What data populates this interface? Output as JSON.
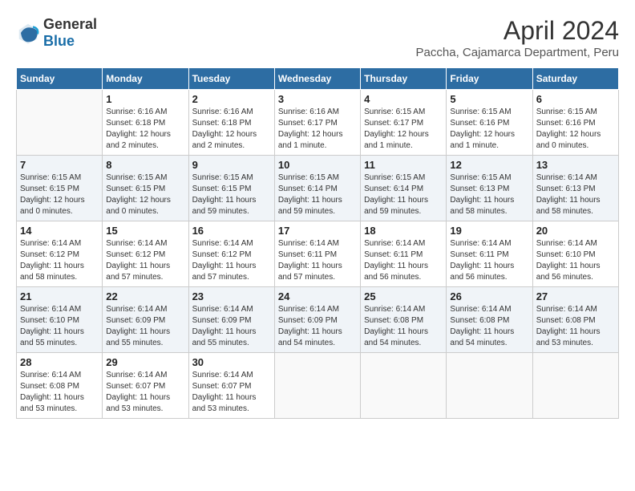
{
  "header": {
    "logo_general": "General",
    "logo_blue": "Blue",
    "title": "April 2024",
    "subtitle": "Paccha, Cajamarca Department, Peru"
  },
  "calendar": {
    "days_of_week": [
      "Sunday",
      "Monday",
      "Tuesday",
      "Wednesday",
      "Thursday",
      "Friday",
      "Saturday"
    ],
    "weeks": [
      [
        {
          "day": "",
          "info": ""
        },
        {
          "day": "1",
          "info": "Sunrise: 6:16 AM\nSunset: 6:18 PM\nDaylight: 12 hours\nand 2 minutes."
        },
        {
          "day": "2",
          "info": "Sunrise: 6:16 AM\nSunset: 6:18 PM\nDaylight: 12 hours\nand 2 minutes."
        },
        {
          "day": "3",
          "info": "Sunrise: 6:16 AM\nSunset: 6:17 PM\nDaylight: 12 hours\nand 1 minute."
        },
        {
          "day": "4",
          "info": "Sunrise: 6:15 AM\nSunset: 6:17 PM\nDaylight: 12 hours\nand 1 minute."
        },
        {
          "day": "5",
          "info": "Sunrise: 6:15 AM\nSunset: 6:16 PM\nDaylight: 12 hours\nand 1 minute."
        },
        {
          "day": "6",
          "info": "Sunrise: 6:15 AM\nSunset: 6:16 PM\nDaylight: 12 hours\nand 0 minutes."
        }
      ],
      [
        {
          "day": "7",
          "info": "Sunrise: 6:15 AM\nSunset: 6:15 PM\nDaylight: 12 hours\nand 0 minutes."
        },
        {
          "day": "8",
          "info": "Sunrise: 6:15 AM\nSunset: 6:15 PM\nDaylight: 12 hours\nand 0 minutes."
        },
        {
          "day": "9",
          "info": "Sunrise: 6:15 AM\nSunset: 6:15 PM\nDaylight: 11 hours\nand 59 minutes."
        },
        {
          "day": "10",
          "info": "Sunrise: 6:15 AM\nSunset: 6:14 PM\nDaylight: 11 hours\nand 59 minutes."
        },
        {
          "day": "11",
          "info": "Sunrise: 6:15 AM\nSunset: 6:14 PM\nDaylight: 11 hours\nand 59 minutes."
        },
        {
          "day": "12",
          "info": "Sunrise: 6:15 AM\nSunset: 6:13 PM\nDaylight: 11 hours\nand 58 minutes."
        },
        {
          "day": "13",
          "info": "Sunrise: 6:14 AM\nSunset: 6:13 PM\nDaylight: 11 hours\nand 58 minutes."
        }
      ],
      [
        {
          "day": "14",
          "info": "Sunrise: 6:14 AM\nSunset: 6:12 PM\nDaylight: 11 hours\nand 58 minutes."
        },
        {
          "day": "15",
          "info": "Sunrise: 6:14 AM\nSunset: 6:12 PM\nDaylight: 11 hours\nand 57 minutes."
        },
        {
          "day": "16",
          "info": "Sunrise: 6:14 AM\nSunset: 6:12 PM\nDaylight: 11 hours\nand 57 minutes."
        },
        {
          "day": "17",
          "info": "Sunrise: 6:14 AM\nSunset: 6:11 PM\nDaylight: 11 hours\nand 57 minutes."
        },
        {
          "day": "18",
          "info": "Sunrise: 6:14 AM\nSunset: 6:11 PM\nDaylight: 11 hours\nand 56 minutes."
        },
        {
          "day": "19",
          "info": "Sunrise: 6:14 AM\nSunset: 6:11 PM\nDaylight: 11 hours\nand 56 minutes."
        },
        {
          "day": "20",
          "info": "Sunrise: 6:14 AM\nSunset: 6:10 PM\nDaylight: 11 hours\nand 56 minutes."
        }
      ],
      [
        {
          "day": "21",
          "info": "Sunrise: 6:14 AM\nSunset: 6:10 PM\nDaylight: 11 hours\nand 55 minutes."
        },
        {
          "day": "22",
          "info": "Sunrise: 6:14 AM\nSunset: 6:09 PM\nDaylight: 11 hours\nand 55 minutes."
        },
        {
          "day": "23",
          "info": "Sunrise: 6:14 AM\nSunset: 6:09 PM\nDaylight: 11 hours\nand 55 minutes."
        },
        {
          "day": "24",
          "info": "Sunrise: 6:14 AM\nSunset: 6:09 PM\nDaylight: 11 hours\nand 54 minutes."
        },
        {
          "day": "25",
          "info": "Sunrise: 6:14 AM\nSunset: 6:08 PM\nDaylight: 11 hours\nand 54 minutes."
        },
        {
          "day": "26",
          "info": "Sunrise: 6:14 AM\nSunset: 6:08 PM\nDaylight: 11 hours\nand 54 minutes."
        },
        {
          "day": "27",
          "info": "Sunrise: 6:14 AM\nSunset: 6:08 PM\nDaylight: 11 hours\nand 53 minutes."
        }
      ],
      [
        {
          "day": "28",
          "info": "Sunrise: 6:14 AM\nSunset: 6:08 PM\nDaylight: 11 hours\nand 53 minutes."
        },
        {
          "day": "29",
          "info": "Sunrise: 6:14 AM\nSunset: 6:07 PM\nDaylight: 11 hours\nand 53 minutes."
        },
        {
          "day": "30",
          "info": "Sunrise: 6:14 AM\nSunset: 6:07 PM\nDaylight: 11 hours\nand 53 minutes."
        },
        {
          "day": "",
          "info": ""
        },
        {
          "day": "",
          "info": ""
        },
        {
          "day": "",
          "info": ""
        },
        {
          "day": "",
          "info": ""
        }
      ]
    ]
  }
}
